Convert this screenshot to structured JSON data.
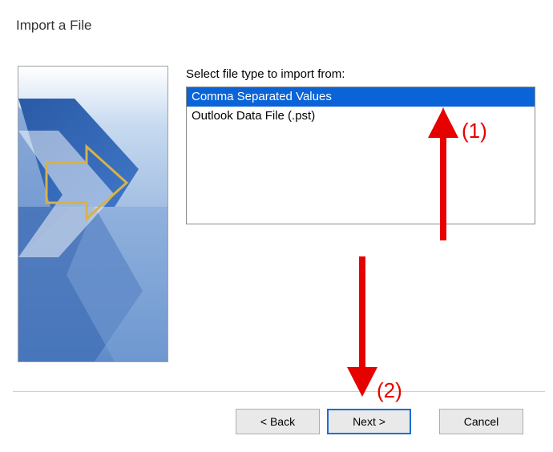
{
  "title": "Import a File",
  "list_label": "Select file type to import from:",
  "file_types": [
    {
      "label": "Comma Separated Values",
      "selected": true
    },
    {
      "label": "Outlook Data File (.pst)",
      "selected": false
    }
  ],
  "buttons": {
    "back": "< Back",
    "next": "Next >",
    "cancel": "Cancel"
  },
  "annotations": {
    "one": "(1)",
    "two": "(2)"
  }
}
